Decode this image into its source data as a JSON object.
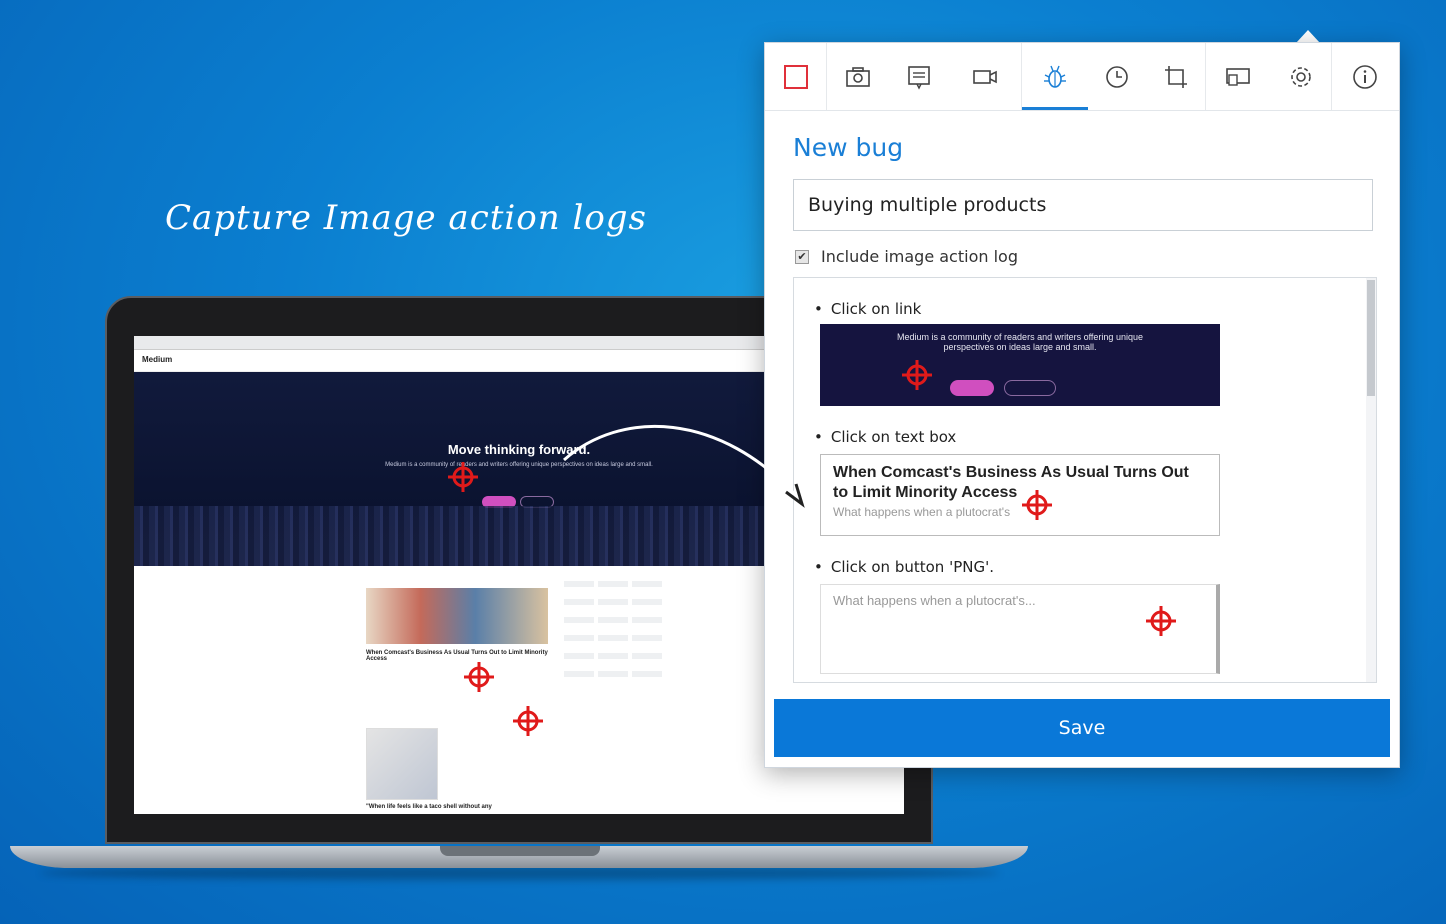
{
  "headline": "Capture Image action logs",
  "laptop": {
    "site_logo": "Medium",
    "hero_title": "Move thinking forward.",
    "hero_sub": "Medium is a community of readers and writers offering unique perspectives on ideas large and small.",
    "card_title": "When Comcast's Business As Usual Turns Out to Limit Minority Access",
    "card_title_2": "\"When life feels like a taco shell without any"
  },
  "panel": {
    "toolbar": [
      {
        "name": "rectangle-icon",
        "color": "#e0303a"
      },
      {
        "name": "camera-icon"
      },
      {
        "name": "note-icon"
      },
      {
        "name": "video-icon"
      },
      {
        "name": "bug-icon",
        "active": true
      },
      {
        "name": "clock-icon"
      },
      {
        "name": "crop-icon"
      },
      {
        "name": "screen-icon"
      },
      {
        "name": "gear-icon"
      },
      {
        "name": "info-icon"
      }
    ],
    "title": "New bug",
    "bug_name_value": "Buying multiple products",
    "include_log_label": "Include image action log",
    "include_log_checked": true,
    "log": [
      {
        "action": "Click on link"
      },
      {
        "action": "Click on text box"
      },
      {
        "action": "Click on button 'PNG'."
      }
    ],
    "thumb1_text": "Medium is a community of readers and writers offering unique perspectives on ideas large and small.",
    "thumb2_title": "When Comcast's Business As Usual Turns Out to Limit Minority Access",
    "thumb2_sub": "What happens when a plutocrat's",
    "thumb3_sub": "What happens when a plutocrat's...",
    "save_label": "Save"
  },
  "colors": {
    "accent": "#1a7fd6",
    "save_button": "#0a78d8",
    "crosshair": "#e01a1a"
  }
}
